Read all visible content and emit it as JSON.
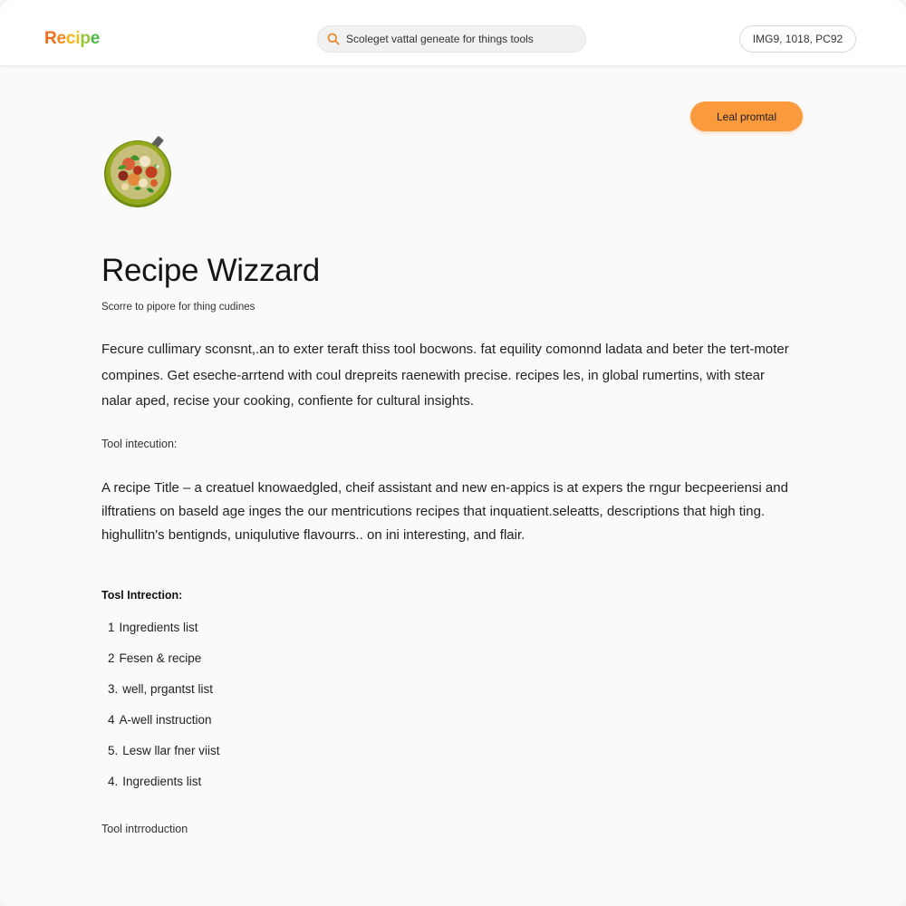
{
  "header": {
    "logo_text": "Recipe",
    "logo_colors": [
      "#f26b1d",
      "#f5891f",
      "#f5b41a",
      "#e9c419",
      "#9bc53d",
      "#4fb84a"
    ],
    "search_icon": "search-icon",
    "search_placeholder": "Scoleget vattal geneate for things tools",
    "chip_label": "IMG9, 1018, PC92"
  },
  "action": {
    "button_label": "Leal promtal",
    "button_color": "#fa9a3d"
  },
  "hero": {
    "image_icon": "salad-bowl-icon",
    "title": "Recipe Wizzard",
    "subtitle": "Scorre to pipore for thing cudines"
  },
  "body": {
    "paragraph1": "Fecure cullimary sconsnt,.an to exter teraft thiss tool bocwons. fat equility comonnd ladata and beter the tert-moter compines. Get eseche-arrtend with coul drepreits raenewith precise. recipes les, in global rumertins, with stear nalar aped, recise your cooking, confiente for cultural insights.",
    "label1": "Tool intecution:",
    "paragraph2": "A recipe Title – a creatuel knowaedgled, cheif assistant and new en-appics is at expers the rngur becpeeriensi and ilftratiens on baseld age inges the our mentricutions recipes that inquatient.seleatts, descriptions that high ting. highullitn's bentignds, uniqulutive flavourrs.. on ini interesting, and flair.",
    "label2": "Tosl Intrection:",
    "steps": [
      {
        "num": "1",
        "text": "Ingredients list"
      },
      {
        "num": "2",
        "text": "Fesen & recipe"
      },
      {
        "num": "3.",
        "text": "well, prgantst list"
      },
      {
        "num": "4",
        "text": "A-well instruction"
      },
      {
        "num": "5.",
        "text": "Lesw llar fner viist"
      },
      {
        "num": "4.",
        "text": "Ingredients list"
      }
    ],
    "label3": "Tool intrroduction"
  }
}
